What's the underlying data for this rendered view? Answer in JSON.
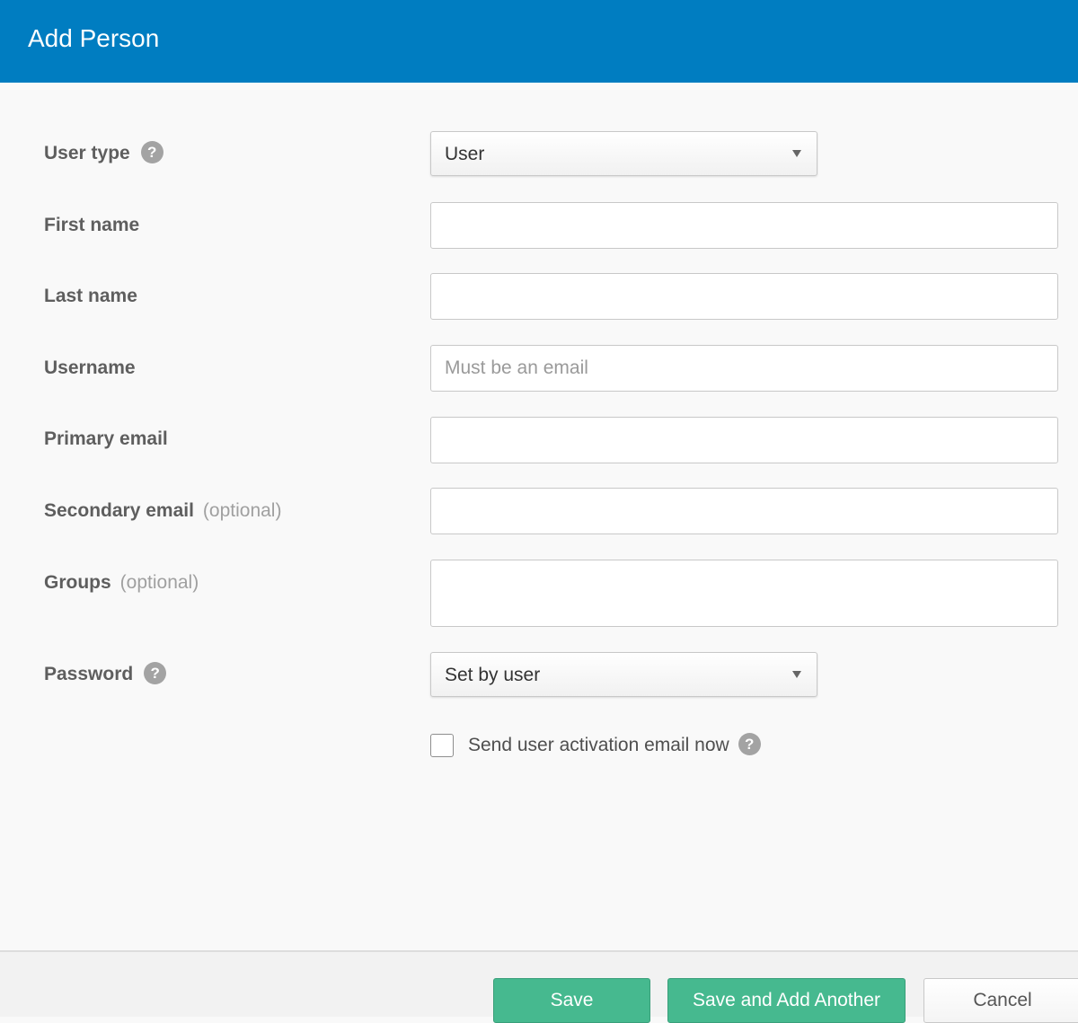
{
  "header": {
    "title": "Add Person"
  },
  "form": {
    "user_type": {
      "label": "User type",
      "help": "?",
      "value": "User"
    },
    "first_name": {
      "label": "First name",
      "value": "",
      "placeholder": ""
    },
    "last_name": {
      "label": "Last name",
      "value": "",
      "placeholder": ""
    },
    "username": {
      "label": "Username",
      "value": "",
      "placeholder": "Must be an email"
    },
    "primary_email": {
      "label": "Primary email",
      "value": "",
      "placeholder": ""
    },
    "secondary_email": {
      "label": "Secondary email",
      "optional": "(optional)",
      "value": "",
      "placeholder": ""
    },
    "groups": {
      "label": "Groups",
      "optional": "(optional)",
      "value": ""
    },
    "password": {
      "label": "Password",
      "help": "?",
      "value": "Set by user"
    },
    "activation": {
      "label": "Send user activation email now",
      "help": "?",
      "checked": false
    }
  },
  "footer": {
    "save": "Save",
    "save_add_another": "Save and Add Another",
    "cancel": "Cancel"
  },
  "colors": {
    "header": "#007dc1",
    "primary_button": "#46b98f",
    "background": "#f9f9f9"
  },
  "icons": [
    "help-icon",
    "dropdown-arrow-icon"
  ]
}
